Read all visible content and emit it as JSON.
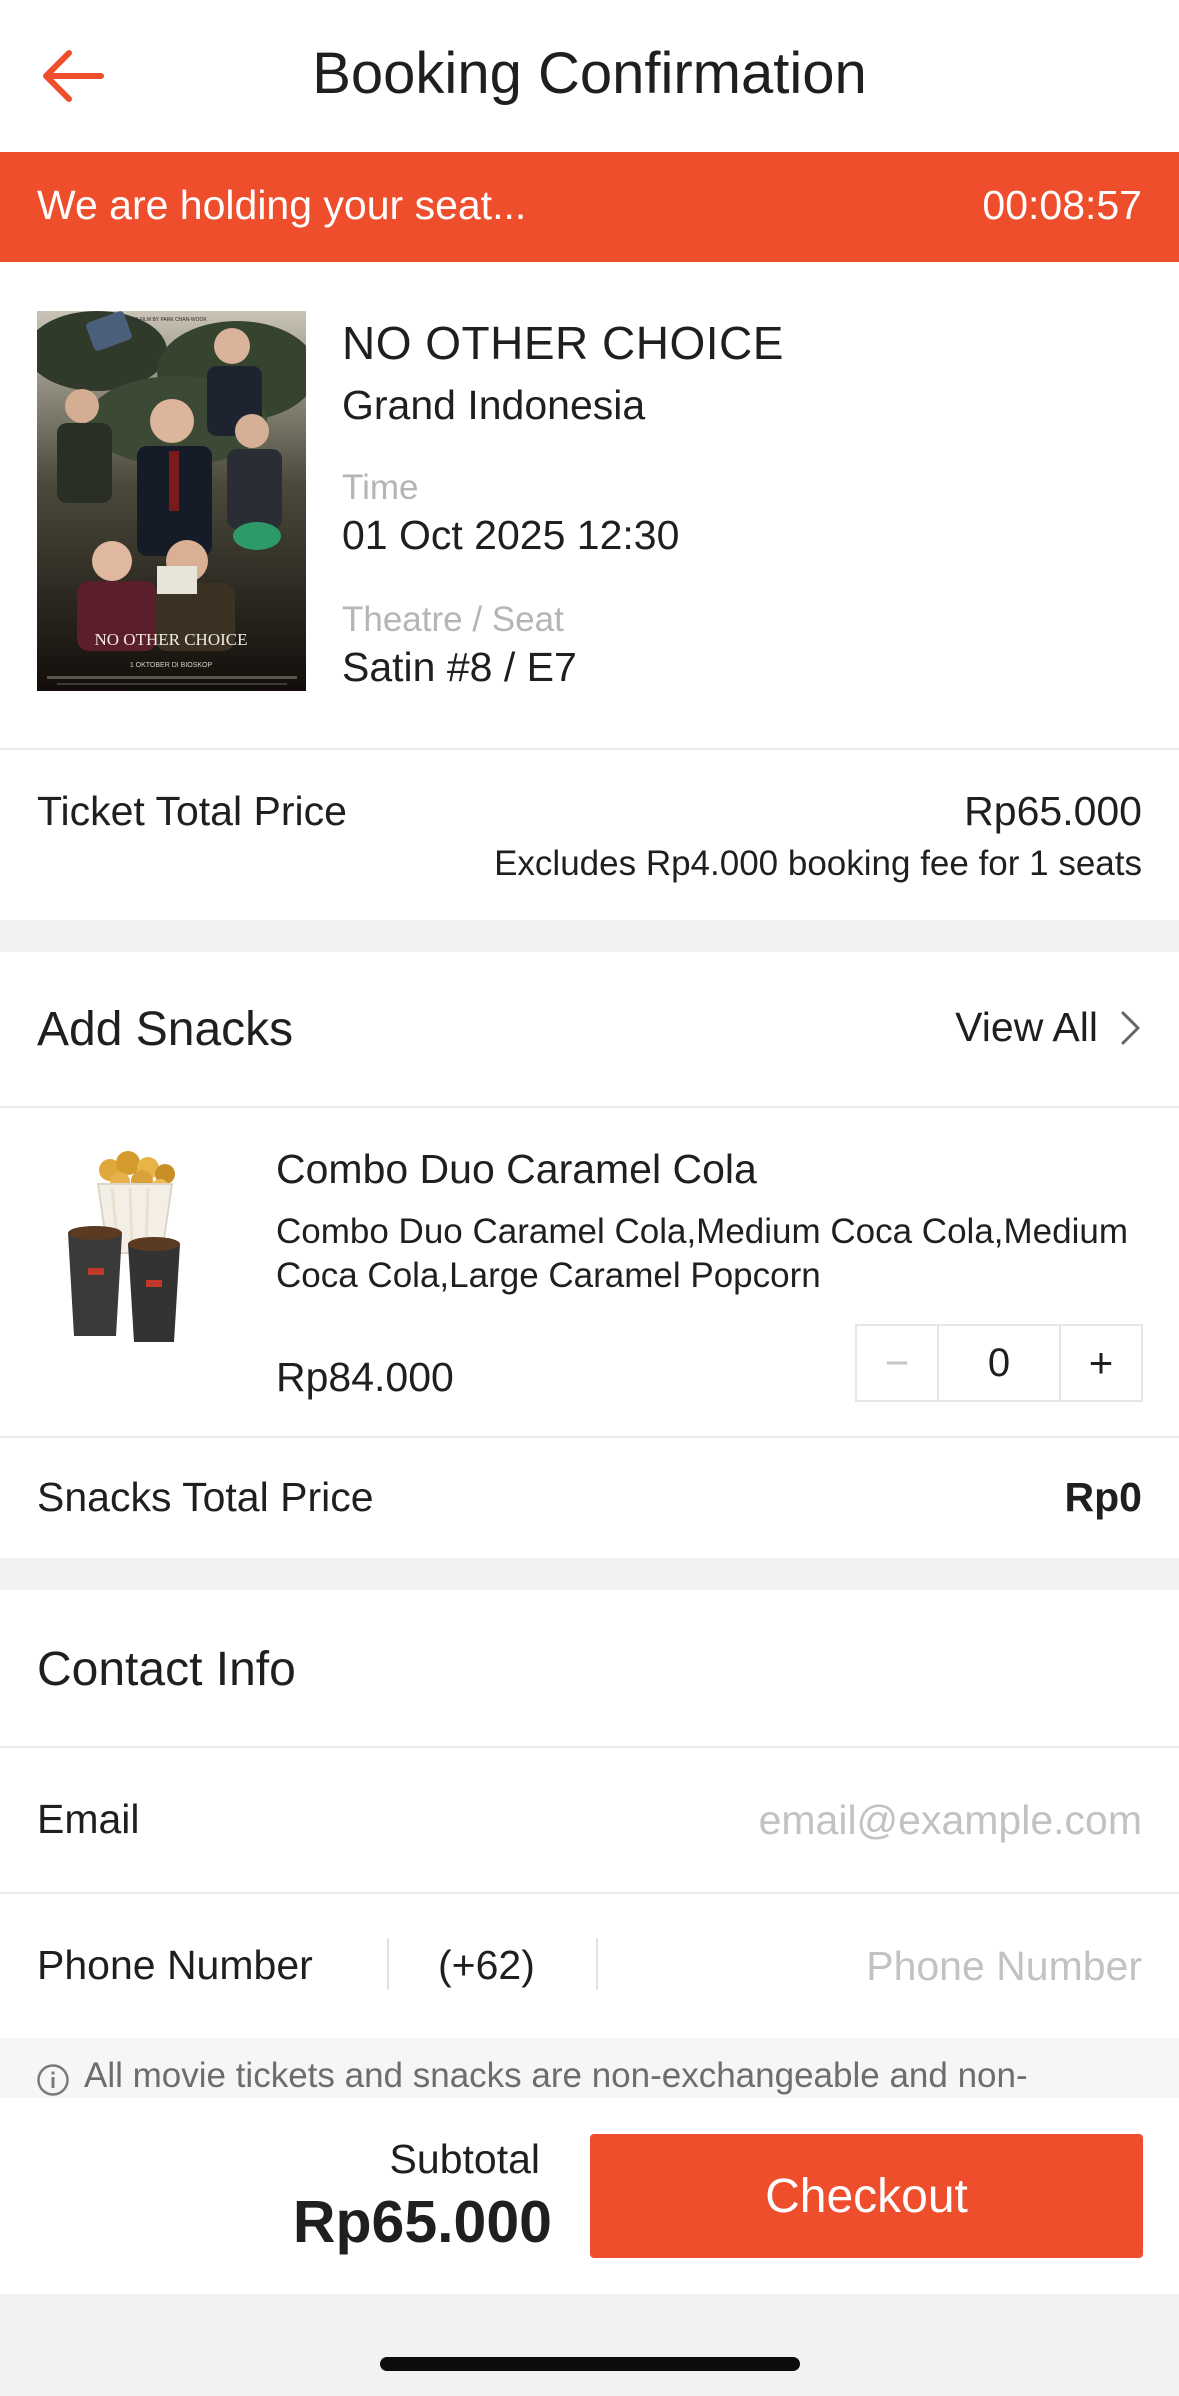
{
  "header": {
    "title": "Booking Confirmation",
    "back_icon": "arrow-left-icon"
  },
  "hold": {
    "message": "We are holding your seat...",
    "timer": "00:08:57"
  },
  "movie": {
    "title": "NO OTHER CHOICE",
    "cinema": "Grand Indonesia",
    "time_label": "Time",
    "time_value": "01 Oct 2025 12:30",
    "seat_label": "Theatre / Seat",
    "seat_value": "Satin #8 / E7",
    "poster": {
      "top_text": "A FILM BY PARK CHAN-WOOK",
      "title_text": "NO OTHER CHOICE",
      "date_text": "1 OKTOBER DI BIOSKOP"
    }
  },
  "ticket": {
    "label": "Ticket Total Price",
    "value": "Rp65.000",
    "fee_note": "Excludes Rp4.000 booking fee for 1 seats"
  },
  "snacks": {
    "title": "Add Snacks",
    "view_all": "View All",
    "items": [
      {
        "name": "Combo Duo Caramel Cola",
        "description": "Combo Duo Caramel Cola,Medium Coca Cola,Medium Coca Cola,Large Caramel Popcorn",
        "price": "Rp84.000",
        "quantity": "0",
        "minus": "−",
        "plus": "+"
      }
    ],
    "total_label": "Snacks Total Price",
    "total_value": "Rp0"
  },
  "contact": {
    "title": "Contact Info",
    "email_label": "Email",
    "email_placeholder": "email@example.com",
    "phone_label": "Phone Number",
    "country_code": "(+62)",
    "phone_placeholder": "Phone Number"
  },
  "notice": {
    "text": "All movie tickets and snacks are non-exchangeable and non-"
  },
  "footer": {
    "subtotal_label": "Subtotal",
    "subtotal_value": "Rp65.000",
    "checkout_label": "Checkout"
  },
  "colors": {
    "accent": "#ee4e2c",
    "section_gap": "#f2f2f2",
    "placeholder": "#c2c2c2"
  }
}
